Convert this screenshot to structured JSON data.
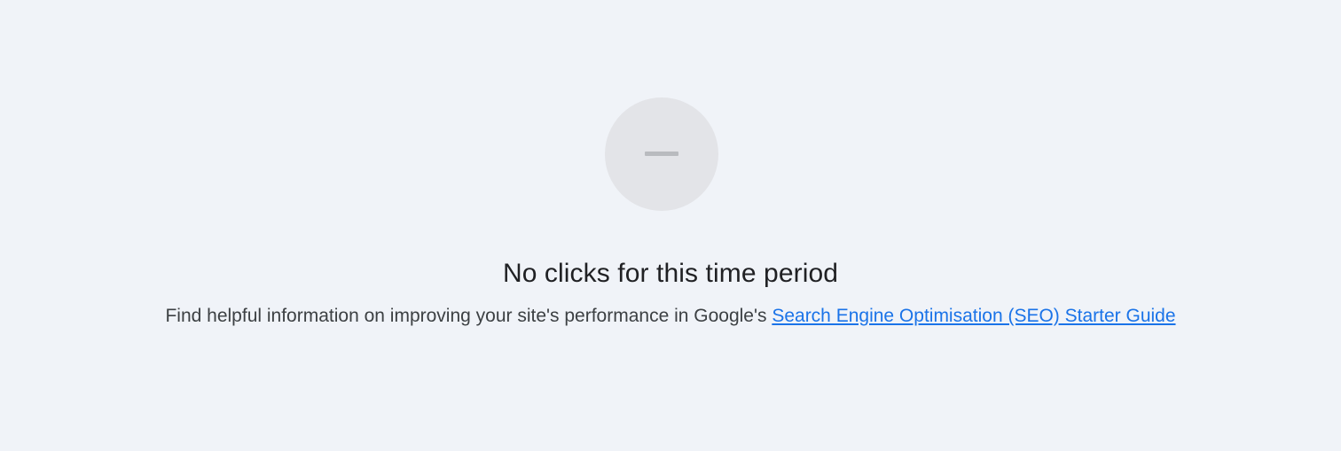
{
  "empty_state": {
    "icon": "minus-icon",
    "title": "No clicks for this time period",
    "description_prefix": "Find helpful information on improving your site's performance in Google's ",
    "link_text": "Search Engine Optimisation (SEO) Starter Guide"
  },
  "colors": {
    "background": "#f0f3f8",
    "icon_circle": "#e3e4e8",
    "icon_dash": "#b9bbbf",
    "title": "#202124",
    "text": "#3c4043",
    "link": "#1a73e8"
  }
}
